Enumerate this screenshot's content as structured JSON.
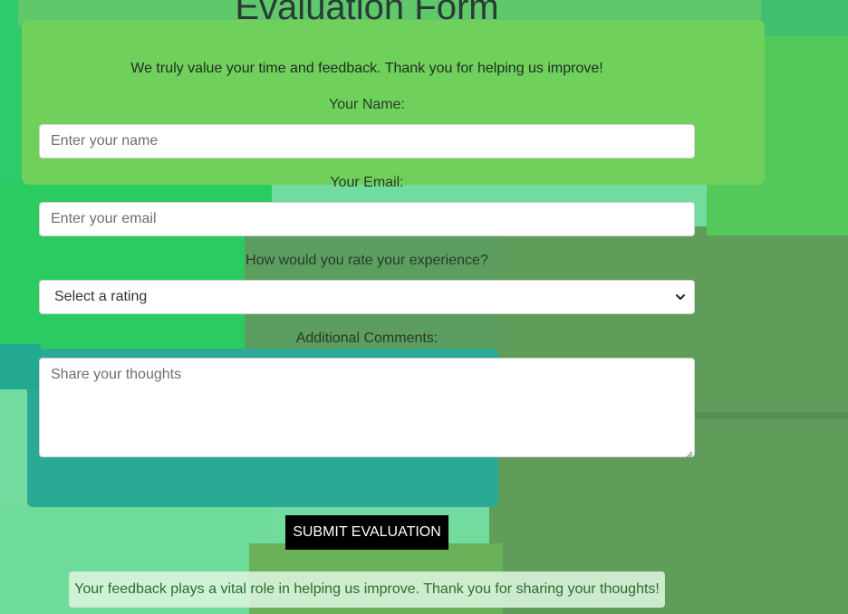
{
  "form": {
    "title": "Evaluation Form",
    "intro": "We truly value your time and feedback. Thank you for helping us improve!",
    "name_label": "Your Name:",
    "name_placeholder": "Enter your name",
    "email_label": "Your Email:",
    "email_placeholder": "Enter your email",
    "rating_label": "How would you rate your experience?",
    "rating_selected": "Select a rating",
    "comments_label": "Additional Comments:",
    "comments_placeholder": "Share your thoughts",
    "submit_label": "SUBMIT EVALUATION"
  },
  "footer": {
    "note": "Your feedback plays a vital role in helping us improve. Thank you for sharing your thoughts!"
  },
  "icons": {
    "select_arrow": "chevron-down-icon",
    "textarea_grip": "resize-grip-icon"
  },
  "colors": {
    "submit_bg": "#000000",
    "submit_text": "#ffffff",
    "note_text": "#2e6b30",
    "note_bg": "#dcf5de"
  }
}
